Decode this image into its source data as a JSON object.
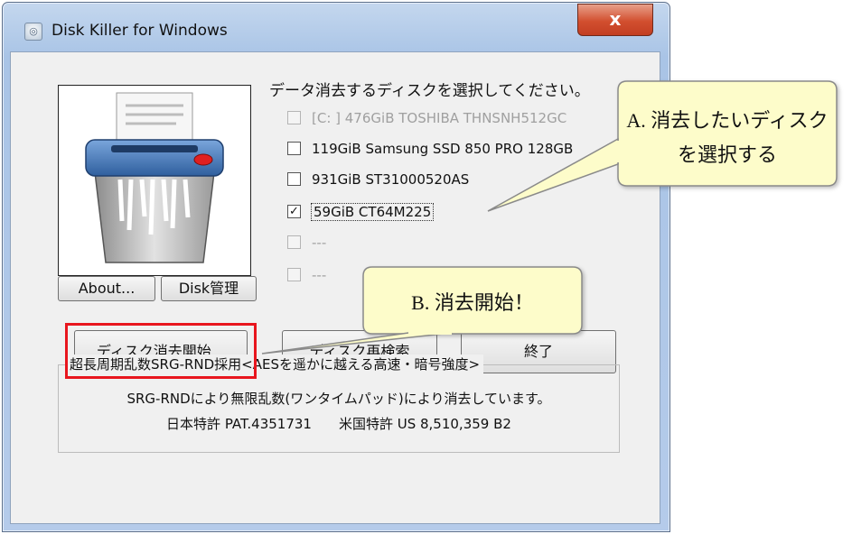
{
  "window": {
    "title": "Disk Killer for Windows",
    "close_label": "x",
    "app_icon": "disk-icon"
  },
  "instruction": "データ消去するディスクを選択してください。",
  "disks": [
    {
      "label": "[C: ] 476GiB TOSHIBA THNSNH512GC",
      "checked": false,
      "enabled": false
    },
    {
      "label": "119GiB Samsung SSD 850 PRO 128GB",
      "checked": false,
      "enabled": true
    },
    {
      "label": "931GiB ST31000520AS",
      "checked": false,
      "enabled": true
    },
    {
      "label": "59GiB CT64M225",
      "checked": true,
      "enabled": true,
      "focused": true
    },
    {
      "label": "---",
      "checked": false,
      "enabled": false
    },
    {
      "label": "---",
      "checked": false,
      "enabled": false
    }
  ],
  "buttons": {
    "about": "About...",
    "disk_manage": "Disk管理",
    "start_erase": "ディスク消去開始...",
    "rescan": "ディスク再検索",
    "exit": "終了"
  },
  "info": {
    "title": "超長周期乱数SRG-RND採用<AESを遥かに越える高速・暗号強度>",
    "line1": "SRG-RNDにより無限乱数(ワンタイムパッド)により消去しています。",
    "line2": "日本特許 PAT.4351731　　米国特許 US 8,510,359 B2"
  },
  "callouts": {
    "a_line1": "A. 消去したいディスク",
    "a_line2": "を選択する",
    "b": "B. 消去開始！"
  },
  "colors": {
    "callout_fill": "#fdfcca",
    "callout_stroke": "#8a8a8a",
    "highlight_red": "#e8161e",
    "close_red": "#d24f2f"
  },
  "icons": {
    "shredder": "paper-shredder-icon"
  }
}
